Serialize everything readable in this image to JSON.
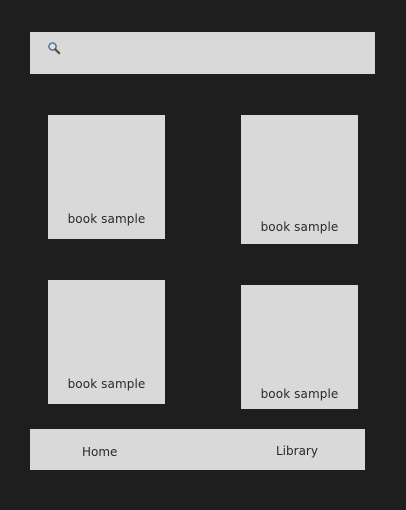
{
  "search": {
    "icon": "search-icon",
    "placeholder": ""
  },
  "books": [
    {
      "label": "book sample"
    },
    {
      "label": "book sample"
    },
    {
      "label": "book sample"
    },
    {
      "label": "book sample"
    }
  ],
  "nav": {
    "home_label": "Home",
    "library_label": "Library"
  },
  "colors": {
    "background": "#1e1e1e",
    "surface": "#d9d9d9",
    "text": "#2a2a2a"
  }
}
